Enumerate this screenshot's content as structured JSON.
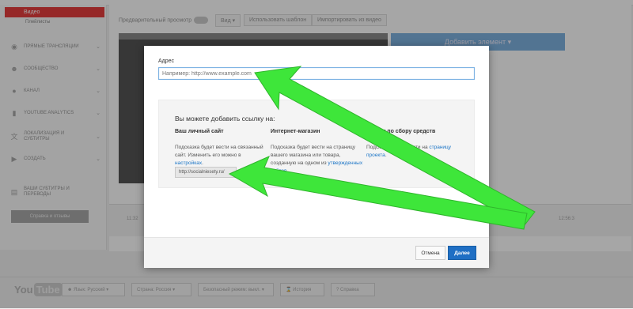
{
  "sidebar": {
    "active_label": "Видео",
    "sub_label": "Плейлисты",
    "items": [
      {
        "icon": "live-icon",
        "glyph": "((•))",
        "label": "Прямые трансляции"
      },
      {
        "icon": "community-icon",
        "glyph": "👥",
        "label": "Сообщество"
      },
      {
        "icon": "channel-icon",
        "glyph": "●",
        "label": "Канал"
      },
      {
        "icon": "analytics-icon",
        "glyph": "▮",
        "label": "YouTube Analytics"
      },
      {
        "icon": "translate-icon",
        "glyph": "文",
        "label": "Локализация и субтитры"
      },
      {
        "icon": "create-icon",
        "glyph": "▶",
        "label": "Создать"
      },
      {
        "icon": "subtitles-icon",
        "glyph": "▤",
        "label": "Ваши субтитры и переводы"
      }
    ],
    "feedback_button": "Справка и отзывы"
  },
  "toolbar": {
    "preview_label": "Предварительный просмотр",
    "view_label": "Вид",
    "use_template": "Использовать шаблон",
    "import_label": "Импортировать из видео",
    "add_element": "Добавить элемент"
  },
  "timeline": {
    "start": "11:32",
    "end": "12:56:3"
  },
  "dialog": {
    "address_label": "Адрес",
    "address_placeholder": "Например: http://www.example.com",
    "box_title": "Вы можете добавить ссылку на:",
    "col1_title": "Ваш личный сайт",
    "col1_text": "Подсказка будет вести на связанный сайт. Изменить его можно в ",
    "col1_link": "настройках",
    "col1_after": ".",
    "col1_site": "http://socialniesety.ru/",
    "col2_title": "Интернет-магазин",
    "col2_text": "Подсказка будет вести на страницу вашего магазина или товара, созданную на одном из ",
    "col2_link": "утвержденных сайтов",
    "col2_after": ".",
    "col3_title": "Проект по сбору средств",
    "col3_text": "Подсказка будет вести на ",
    "col3_link": "страницу проекта",
    "col3_after": ".",
    "cancel": "Отмена",
    "next": "Далее"
  },
  "bottom_bar": {
    "logo_you": "You",
    "logo_tube": "Tube",
    "language": "Язык: Русский",
    "country": "Страна: Россия",
    "safe_mode": "Безопасный режим: выкл.",
    "history": "История",
    "help": "Справка"
  },
  "colors": {
    "arrow": "#3ee63a",
    "accent": "#1f6fc4",
    "active": "#e63e3e"
  }
}
